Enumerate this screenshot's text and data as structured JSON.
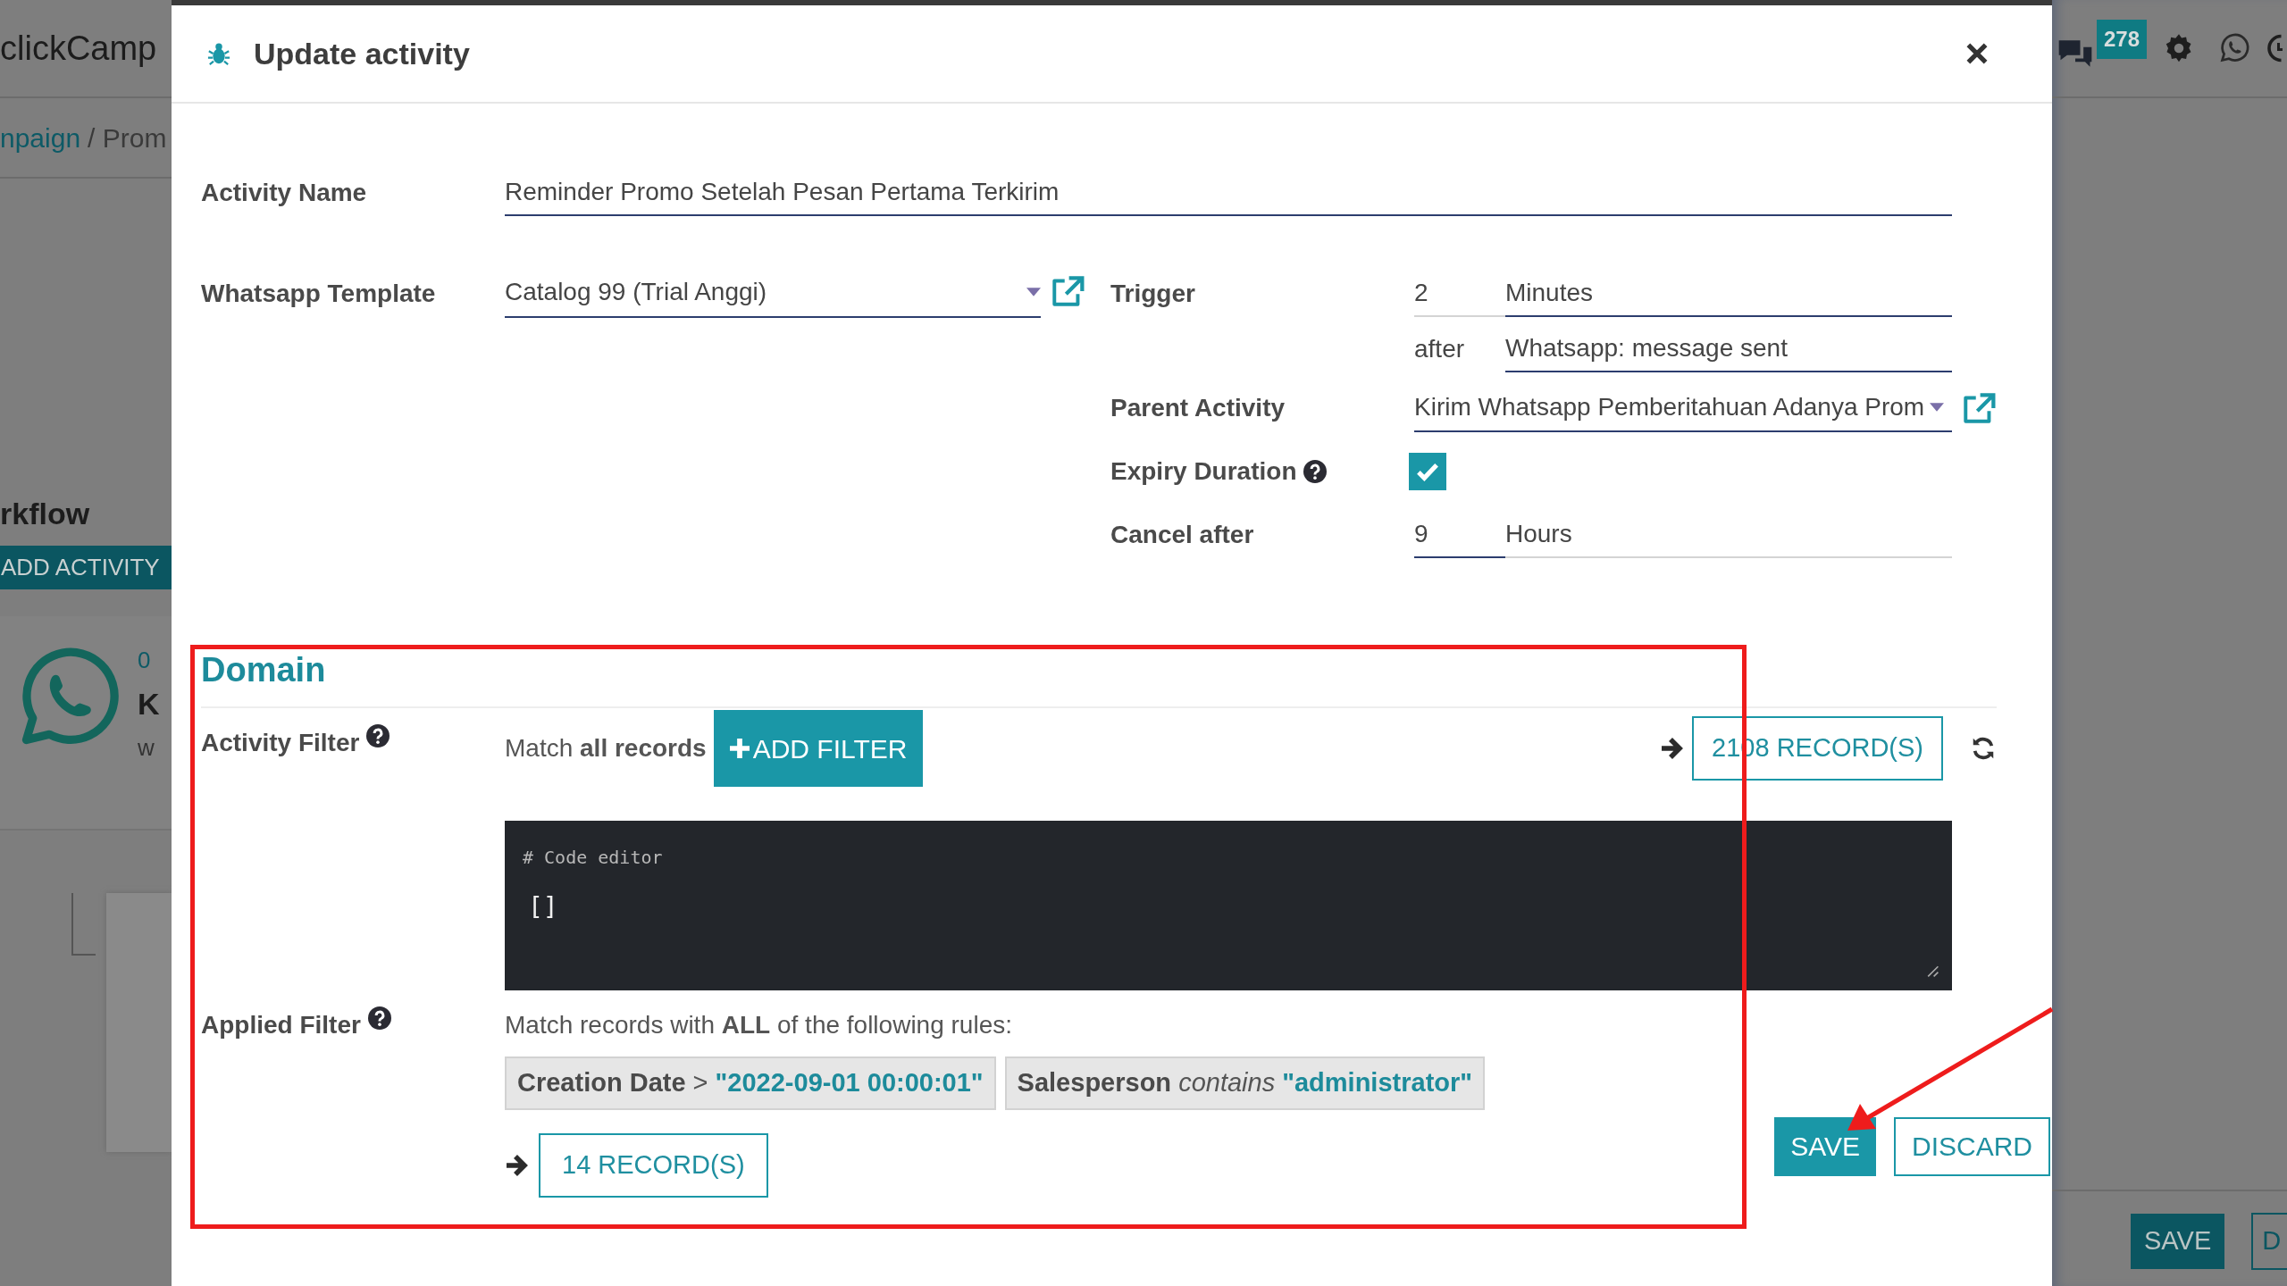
{
  "background": {
    "app_title": "clickCamp",
    "breadcrumb": [
      {
        "text": "npaign",
        "link": true
      },
      {
        "text": "/ Prom",
        "link": false
      }
    ],
    "heading": "rkflow",
    "add_button": "ADD ACTIVITY",
    "card_texts": [
      "0",
      "K",
      "w"
    ],
    "message_badge": "278",
    "save_button": "SAVE",
    "button_fragment": "D"
  },
  "dialog": {
    "title": "Update activity",
    "activity_name": {
      "label": "Activity Name",
      "value": "Reminder Promo Setelah Pesan Pertama Terkirim"
    },
    "whatsapp_template": {
      "label": "Whatsapp Template",
      "value": "Catalog 99 (Trial Anggi)"
    },
    "trigger": {
      "label": "Trigger",
      "amount": "2",
      "unit": "Minutes",
      "after_label": "after",
      "event": "Whatsapp: message sent"
    },
    "parent_activity": {
      "label": "Parent Activity",
      "value": "Kirim Whatsapp Pemberitahuan Adanya Prom"
    },
    "expiry_duration": {
      "label": "Expiry Duration",
      "checked": true
    },
    "cancel_after": {
      "label": "Cancel after",
      "amount": "9",
      "unit": "Hours"
    },
    "domain": {
      "title": "Domain",
      "activity_filter": {
        "label": "Activity Filter",
        "match_text": "Match **all records**",
        "add_button": "ADD FILTER",
        "records_button": "2108 RECORD(S)",
        "code_comment": "# Code editor",
        "code": "[]"
      },
      "applied_filter": {
        "label": "Applied Filter",
        "match_text": "Match records with **ALL** of the following rules:",
        "rules": [
          {
            "field": "Creation Date",
            "operator": ">",
            "value": "\"2022-09-01 00:00:01\""
          },
          {
            "field": "Salesperson",
            "operator": "*contains*",
            "value": "\"administrator\""
          }
        ],
        "records_button": "14 RECORD(S)"
      }
    },
    "buttons": [
      {
        "label": "SAVE",
        "kind": "primary"
      },
      {
        "label": "DISCARD",
        "kind": "secondary"
      }
    ]
  },
  "annotations": {
    "highlight_box": true,
    "pointer_arrow": true
  }
}
